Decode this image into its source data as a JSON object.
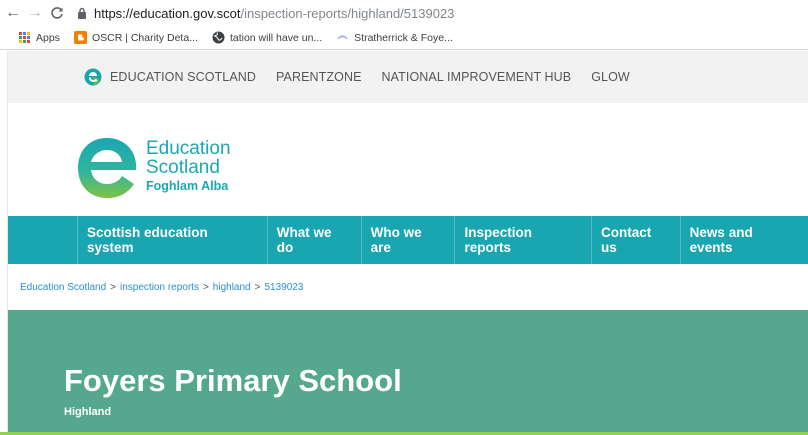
{
  "browser": {
    "url_host": "https://education.gov.scot",
    "url_path": "/inspection-reports/highland/5139023",
    "bookmarks": [
      {
        "label": "Apps",
        "icon": "apps-grid-icon"
      },
      {
        "label": "OSCR | Charity Deta...",
        "icon": "blogger-icon",
        "color": "#f57d00"
      },
      {
        "label": "tation will have un...",
        "icon": "globe-icon"
      },
      {
        "label": "Stratherrick & Foye...",
        "icon": "favicon-icon"
      }
    ]
  },
  "topbar": {
    "links": [
      "EDUCATION SCOTLAND",
      "PARENTZONE",
      "NATIONAL IMPROVEMENT HUB",
      "GLOW"
    ]
  },
  "brand": {
    "line1": "Education",
    "line2": "Scotland",
    "line3": "Foghlam Alba"
  },
  "mainnav": {
    "items": [
      "Scottish education system",
      "What we do",
      "Who we are",
      "Inspection reports",
      "Contact us",
      "News and events"
    ]
  },
  "breadcrumb": {
    "items": [
      "Education Scotland",
      "inspection reports",
      "highland"
    ],
    "separator": ">",
    "current": "5139023"
  },
  "hero": {
    "title": "Foyers Primary School",
    "subtitle": "Highland"
  },
  "colors": {
    "teal": "#1aa6b1",
    "green_hero": "#55a88e",
    "link_blue": "#2a8fd0"
  }
}
